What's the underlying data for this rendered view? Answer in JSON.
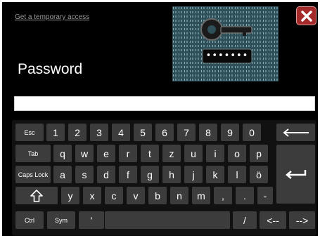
{
  "header": {
    "temp_access_link": "Get a temporary access",
    "close_icon": "close-icon"
  },
  "banner": {
    "icon": "key-with-password-icon",
    "password_mask": "•••••••"
  },
  "form": {
    "title": "Password",
    "password_value": ""
  },
  "keyboard": {
    "row1": [
      "Esc",
      "1",
      "2",
      "3",
      "4",
      "5",
      "6",
      "7",
      "8",
      "9",
      "0"
    ],
    "row2": [
      "Tab",
      "q",
      "w",
      "e",
      "r",
      "t",
      "z",
      "u",
      "i",
      "o",
      "p"
    ],
    "row3": [
      "Caps Lock",
      "a",
      "s",
      "d",
      "f",
      "g",
      "h",
      "j",
      "k",
      "l",
      "ö"
    ],
    "row4": [
      "y",
      "x",
      "c",
      "v",
      "b",
      "n",
      "m",
      ",",
      ".",
      "-"
    ],
    "row5": [
      "Ctrl",
      "Sym",
      "'",
      "/",
      "<--",
      "-->"
    ],
    "backspace_icon": "backspace-arrow-icon",
    "enter_icon": "enter-return-icon",
    "shift_icon": "shift-arrow-icon",
    "space_label": ""
  }
}
